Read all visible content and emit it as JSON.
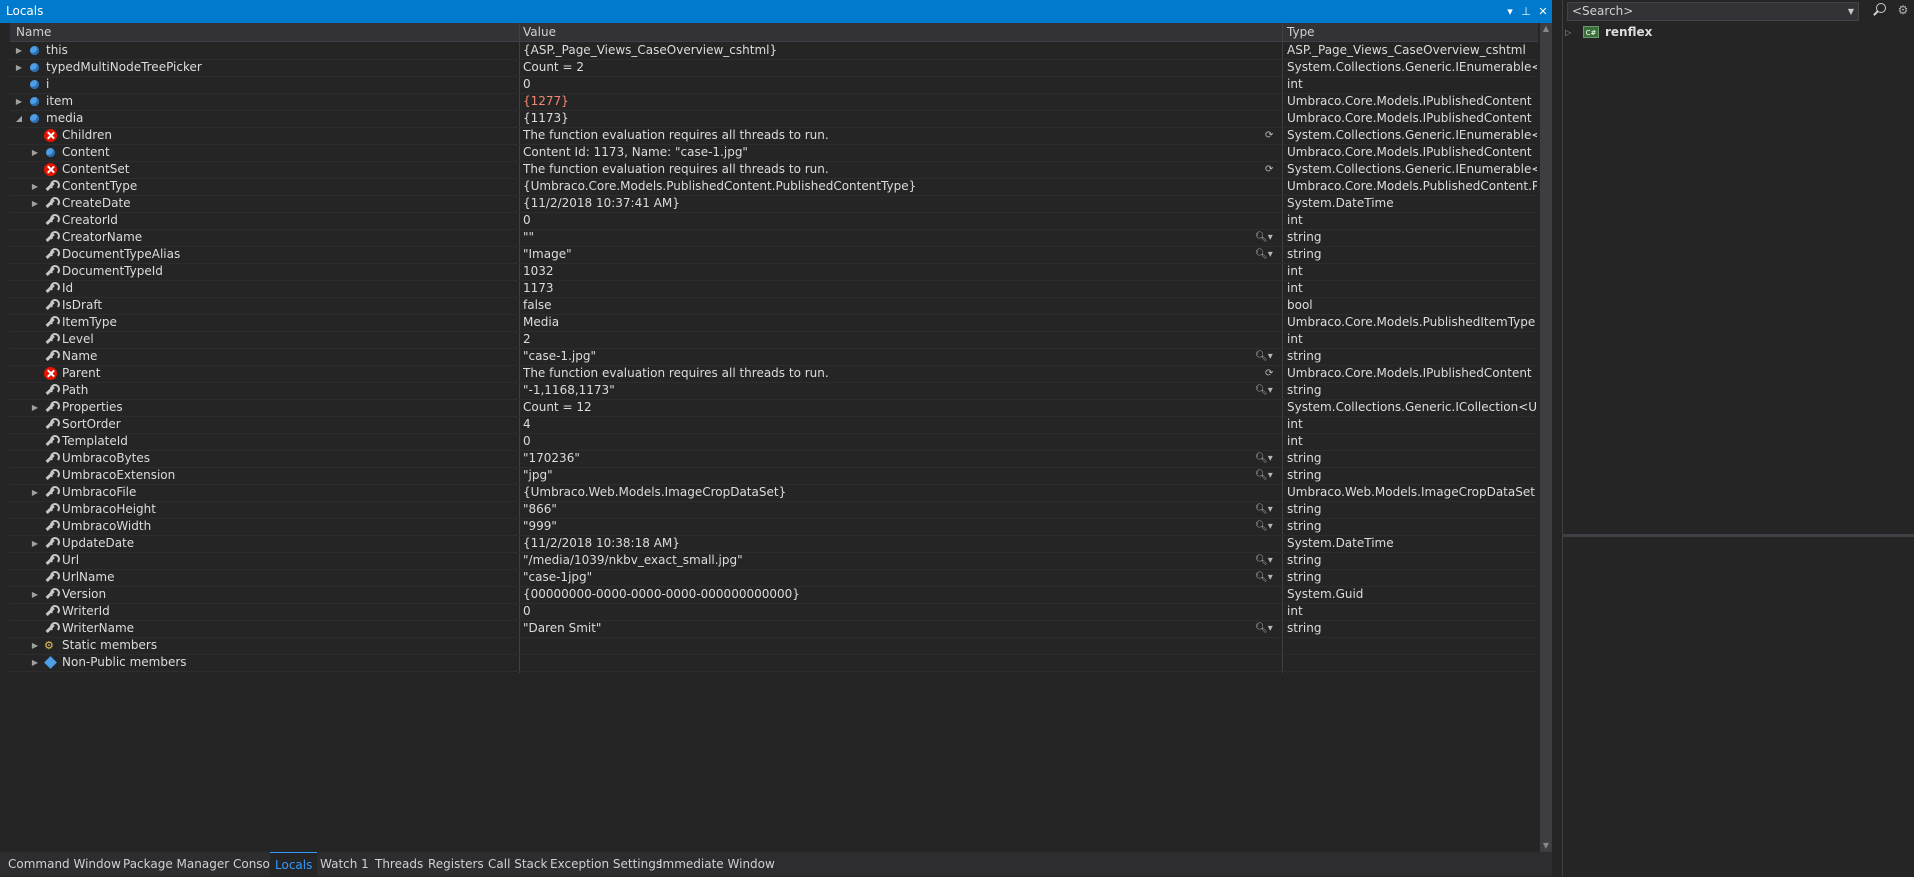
{
  "locals_panel": {
    "title": "Locals",
    "controls": [
      "▾",
      "⊥",
      "✕"
    ],
    "columns": {
      "name": "Name",
      "value": "Value",
      "type": "Type"
    },
    "rows": [
      {
        "depth": 0,
        "expand": "collapsed",
        "icon": "field",
        "name": "this",
        "value": "{ASP._Page_Views_CaseOverview_cshtml}",
        "type": "ASP._Page_Views_CaseOverview_cshtml"
      },
      {
        "depth": 0,
        "expand": "collapsed",
        "icon": "field",
        "name": "typedMultiNodeTreePicker",
        "value": "Count = 2",
        "type": "System.Collections.Generic.IEnumerable<Um..."
      },
      {
        "depth": 0,
        "expand": "none",
        "icon": "field",
        "name": "i",
        "value": "0",
        "type": "int"
      },
      {
        "depth": 0,
        "expand": "collapsed",
        "icon": "field",
        "name": "item",
        "value": "{1277}",
        "type": "Umbraco.Core.Models.IPublishedContent {U...",
        "changed": true
      },
      {
        "depth": 0,
        "expand": "expanded",
        "icon": "field",
        "name": "media",
        "value": "{1173}",
        "type": "Umbraco.Core.Models.IPublishedContent {U..."
      },
      {
        "depth": 1,
        "expand": "none",
        "icon": "error",
        "name": "Children",
        "value": "The function evaluation requires all threads to run.",
        "type": "System.Collections.Generic.IEnumerable<Um...",
        "refresh": true
      },
      {
        "depth": 1,
        "expand": "collapsed",
        "icon": "field",
        "name": "Content",
        "value": "Content Id: 1173, Name: \"case-1.jpg\"",
        "type": "Umbraco.Core.Models.IPublishedContent {U..."
      },
      {
        "depth": 1,
        "expand": "none",
        "icon": "error",
        "name": "ContentSet",
        "value": "The function evaluation requires all threads to run.",
        "type": "System.Collections.Generic.IEnumerable<Um...",
        "refresh": true
      },
      {
        "depth": 1,
        "expand": "collapsed",
        "icon": "wrench",
        "name": "ContentType",
        "value": "{Umbraco.Core.Models.PublishedContent.PublishedContentType}",
        "type": "Umbraco.Core.Models.PublishedContent.Pu..."
      },
      {
        "depth": 1,
        "expand": "collapsed",
        "icon": "wrench",
        "name": "CreateDate",
        "value": "{11/2/2018 10:37:41 AM}",
        "type": "System.DateTime"
      },
      {
        "depth": 1,
        "expand": "none",
        "icon": "wrench",
        "name": "CreatorId",
        "value": "0",
        "type": "int"
      },
      {
        "depth": 1,
        "expand": "none",
        "icon": "wrench",
        "name": "CreatorName",
        "value": "\"\"",
        "type": "string",
        "viz": true
      },
      {
        "depth": 1,
        "expand": "none",
        "icon": "wrench",
        "name": "DocumentTypeAlias",
        "value": "\"Image\"",
        "type": "string",
        "viz": true
      },
      {
        "depth": 1,
        "expand": "none",
        "icon": "wrench",
        "name": "DocumentTypeId",
        "value": "1032",
        "type": "int"
      },
      {
        "depth": 1,
        "expand": "none",
        "icon": "wrench",
        "name": "Id",
        "value": "1173",
        "type": "int"
      },
      {
        "depth": 1,
        "expand": "none",
        "icon": "wrench",
        "name": "IsDraft",
        "value": "false",
        "type": "bool"
      },
      {
        "depth": 1,
        "expand": "none",
        "icon": "wrench",
        "name": "ItemType",
        "value": "Media",
        "type": "Umbraco.Core.Models.PublishedItemType"
      },
      {
        "depth": 1,
        "expand": "none",
        "icon": "wrench",
        "name": "Level",
        "value": "2",
        "type": "int"
      },
      {
        "depth": 1,
        "expand": "none",
        "icon": "wrench",
        "name": "Name",
        "value": "\"case-1.jpg\"",
        "type": "string",
        "viz": true
      },
      {
        "depth": 1,
        "expand": "none",
        "icon": "error",
        "name": "Parent",
        "value": "The function evaluation requires all threads to run.",
        "type": "Umbraco.Core.Models.IPublishedContent",
        "refresh": true
      },
      {
        "depth": 1,
        "expand": "none",
        "icon": "wrench",
        "name": "Path",
        "value": "\"-1,1168,1173\"",
        "type": "string",
        "viz": true
      },
      {
        "depth": 1,
        "expand": "collapsed",
        "icon": "wrench",
        "name": "Properties",
        "value": "Count = 12",
        "type": "System.Collections.Generic.ICollection<Umb..."
      },
      {
        "depth": 1,
        "expand": "none",
        "icon": "wrench",
        "name": "SortOrder",
        "value": "4",
        "type": "int"
      },
      {
        "depth": 1,
        "expand": "none",
        "icon": "wrench",
        "name": "TemplateId",
        "value": "0",
        "type": "int"
      },
      {
        "depth": 1,
        "expand": "none",
        "icon": "wrench",
        "name": "UmbracoBytes",
        "value": "\"170236\"",
        "type": "string",
        "viz": true
      },
      {
        "depth": 1,
        "expand": "none",
        "icon": "wrench",
        "name": "UmbracoExtension",
        "value": "\"jpg\"",
        "type": "string",
        "viz": true
      },
      {
        "depth": 1,
        "expand": "collapsed",
        "icon": "wrench",
        "name": "UmbracoFile",
        "value": "{Umbraco.Web.Models.ImageCropDataSet}",
        "type": "Umbraco.Web.Models.ImageCropDataSet"
      },
      {
        "depth": 1,
        "expand": "none",
        "icon": "wrench",
        "name": "UmbracoHeight",
        "value": "\"866\"",
        "type": "string",
        "viz": true
      },
      {
        "depth": 1,
        "expand": "none",
        "icon": "wrench",
        "name": "UmbracoWidth",
        "value": "\"999\"",
        "type": "string",
        "viz": true
      },
      {
        "depth": 1,
        "expand": "collapsed",
        "icon": "wrench",
        "name": "UpdateDate",
        "value": "{11/2/2018 10:38:18 AM}",
        "type": "System.DateTime"
      },
      {
        "depth": 1,
        "expand": "none",
        "icon": "wrench",
        "name": "Url",
        "value": "\"/media/1039/nkbv_exact_small.jpg\"",
        "type": "string",
        "viz": true
      },
      {
        "depth": 1,
        "expand": "none",
        "icon": "wrench",
        "name": "UrlName",
        "value": "\"case-1jpg\"",
        "type": "string",
        "viz": true
      },
      {
        "depth": 1,
        "expand": "collapsed",
        "icon": "wrench",
        "name": "Version",
        "value": "{00000000-0000-0000-0000-000000000000}",
        "type": "System.Guid"
      },
      {
        "depth": 1,
        "expand": "none",
        "icon": "wrench",
        "name": "WriterId",
        "value": "0",
        "type": "int"
      },
      {
        "depth": 1,
        "expand": "none",
        "icon": "wrench",
        "name": "WriterName",
        "value": "\"Daren Smit\"",
        "type": "string",
        "viz": true
      },
      {
        "depth": 1,
        "expand": "collapsed",
        "icon": "static",
        "name": "Static members",
        "value": "",
        "type": ""
      },
      {
        "depth": 1,
        "expand": "collapsed",
        "icon": "class",
        "name": "Non-Public members",
        "value": "",
        "type": ""
      }
    ]
  },
  "bottom_tabs": [
    {
      "label": "Command Window",
      "active": false
    },
    {
      "label": "Package Manager Console",
      "active": false
    },
    {
      "label": "Locals",
      "active": true
    },
    {
      "label": "Watch 1",
      "active": false
    },
    {
      "label": "Threads",
      "active": false
    },
    {
      "label": "Registers",
      "active": false
    },
    {
      "label": "Call Stack",
      "active": false
    },
    {
      "label": "Exception Settings",
      "active": false
    },
    {
      "label": "Immediate Window",
      "active": false
    }
  ],
  "right_panel": {
    "search_placeholder": "<Search>",
    "tree_item": {
      "icon": "csharp-project-icon",
      "icon_text": "C#",
      "label": "renflex"
    }
  },
  "colors": {
    "accent": "#007acc",
    "active_tab": "#3399ff",
    "changed_value": "#f48771",
    "error": "#e51400"
  }
}
